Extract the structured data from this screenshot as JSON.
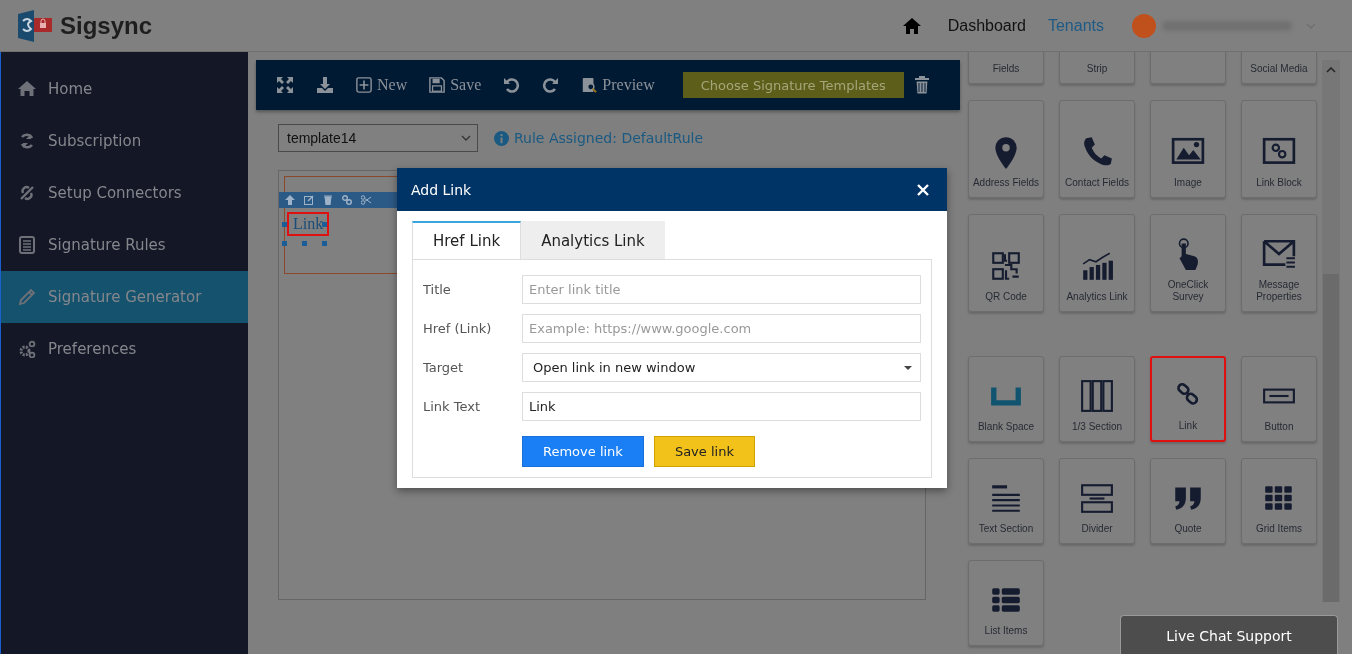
{
  "header": {
    "logo_text": "Sigsync",
    "nav": [
      {
        "label": "Dashboard",
        "selected": false
      },
      {
        "label": "Tenants",
        "selected": true
      }
    ]
  },
  "sidebar": {
    "items": [
      {
        "label": "Home",
        "selected": false
      },
      {
        "label": "Subscription",
        "selected": false
      },
      {
        "label": "Setup Connectors",
        "selected": false
      },
      {
        "label": "Signature Rules",
        "selected": false
      },
      {
        "label": "Signature Generator",
        "selected": true
      },
      {
        "label": "Preferences",
        "selected": false
      }
    ]
  },
  "toolbar": {
    "new": "New",
    "save": "Save",
    "preview": "Preview",
    "templates_button": "Choose Signature Templates"
  },
  "template_select": {
    "value": "template14"
  },
  "rule_assigned": "Rule Assigned: DefaultRule",
  "canvas": {
    "link_text": "Link",
    "selected": true
  },
  "palette": {
    "tiles": [
      {
        "label": "Fields",
        "selected": false
      },
      {
        "label": "Strip",
        "selected": false
      },
      {
        "selected": false
      },
      {
        "label": "Social Media",
        "selected": false
      },
      {
        "label": "Address Fields",
        "selected": false
      },
      {
        "label": "Contact Fields",
        "selected": false
      },
      {
        "label": "Image",
        "selected": false
      },
      {
        "label": "Link Block",
        "selected": false
      },
      {
        "label": "QR Code",
        "selected": false
      },
      {
        "label": "Analytics Link",
        "selected": false
      },
      {
        "label": "OneClick Survey",
        "selected": false
      },
      {
        "label": "Message Properties",
        "selected": false
      },
      {
        "label": "Blank Space",
        "selected": false
      },
      {
        "label": "1/3 Section",
        "selected": false
      },
      {
        "label": "Link",
        "selected": true
      },
      {
        "label": "Button",
        "selected": false
      },
      {
        "label": "Text Section",
        "selected": false
      },
      {
        "label": "Divider",
        "selected": false
      },
      {
        "label": "Quote",
        "selected": false
      },
      {
        "label": "Grid Items",
        "selected": false
      },
      {
        "label": "List Items",
        "selected": false
      }
    ]
  },
  "modal": {
    "title": "Add Link",
    "tabs": [
      {
        "label": "Href Link",
        "selected": true
      },
      {
        "label": "Analytics Link",
        "selected": false
      }
    ],
    "fields": [
      {
        "label": "Title",
        "kind": "text",
        "placeholder": "Enter link title"
      },
      {
        "label": "Href (Link)",
        "kind": "text",
        "placeholder": "Example: https://www.google.com"
      },
      {
        "label": "Target",
        "kind": "select",
        "value": "Open link in new window"
      },
      {
        "label": "Link Text",
        "kind": "text",
        "value": "Link"
      }
    ],
    "remove_button": "Remove link",
    "save_button": "Save link"
  },
  "live_chat": "Live Chat Support"
}
